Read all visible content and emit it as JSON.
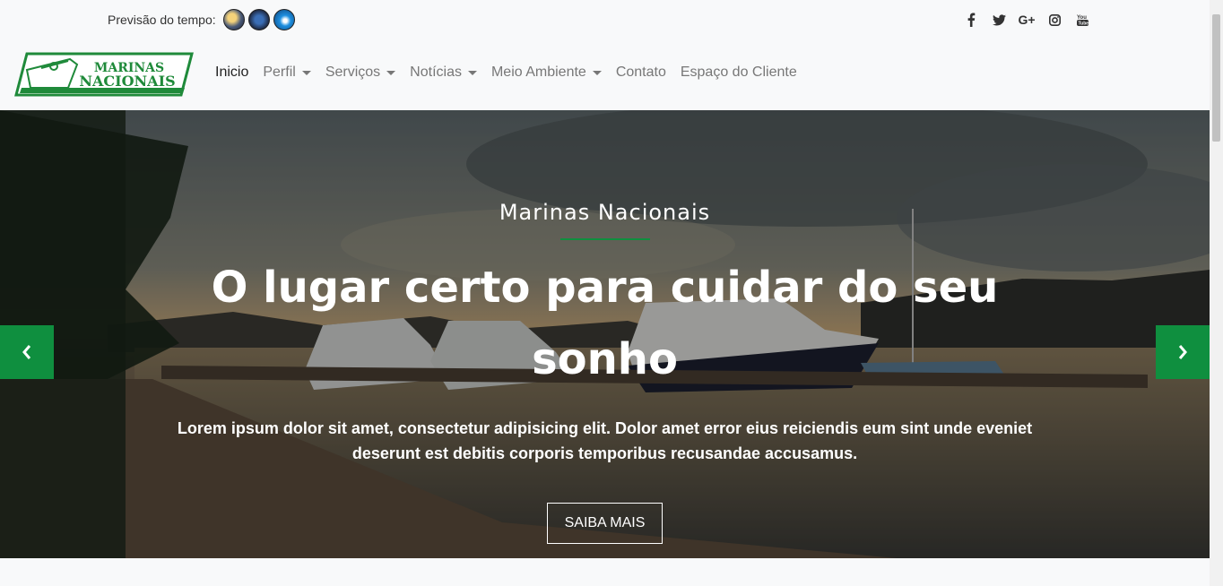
{
  "topbar": {
    "forecast_label": "Previsão do tempo:",
    "weather_icons": [
      "weather-sun-icon",
      "weather-cloud-icon",
      "weather-wave-icon"
    ],
    "social": [
      {
        "name": "facebook-icon",
        "glyph": "f"
      },
      {
        "name": "twitter-icon",
        "glyph": "🐦"
      },
      {
        "name": "google-plus-icon",
        "glyph": "G+"
      },
      {
        "name": "instagram-icon",
        "glyph": "◘"
      },
      {
        "name": "youtube-icon",
        "glyph": "▶"
      }
    ]
  },
  "logo": {
    "line1": "MARINAS",
    "line2": "NACIONAIS"
  },
  "nav": {
    "items": [
      {
        "label": "Inicio",
        "dropdown": false,
        "active": true
      },
      {
        "label": "Perfil",
        "dropdown": true
      },
      {
        "label": "Serviços",
        "dropdown": true
      },
      {
        "label": "Notícias",
        "dropdown": true
      },
      {
        "label": "Meio Ambiente",
        "dropdown": true
      },
      {
        "label": "Contato",
        "dropdown": false
      },
      {
        "label": "Espaço do Cliente",
        "dropdown": false
      }
    ]
  },
  "hero": {
    "subtitle": "Marinas Nacionais",
    "title": "O lugar certo para cuidar do seu sonho",
    "text": "Lorem ipsum dolor sit amet, consectetur adipisicing elit. Dolor amet error eius reiciendis eum sint unde eveniet deserunt est debitis corporis temporibus recusandae accusamus.",
    "button": "SAIBA MAIS"
  },
  "colors": {
    "accent": "#0f8f3f"
  }
}
